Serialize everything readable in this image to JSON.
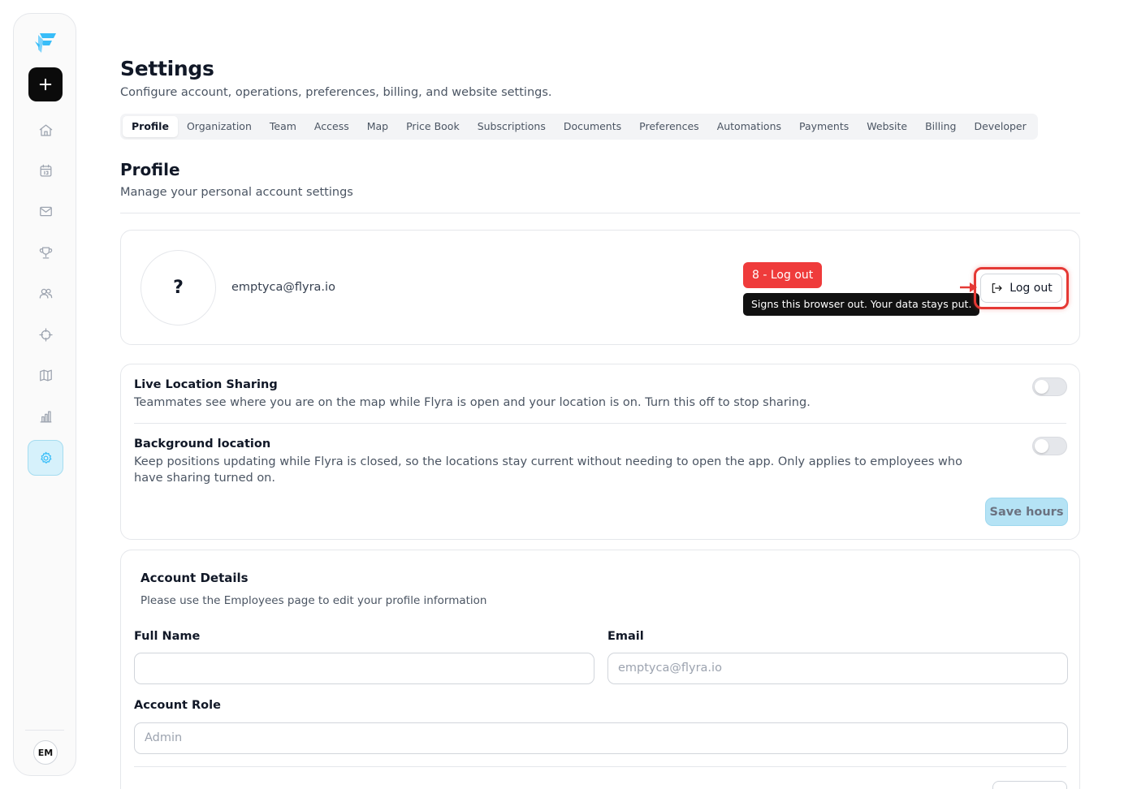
{
  "sidebar": {
    "logo": "flyra-logo-icon",
    "new_button_icon": "plus-icon",
    "items": [
      {
        "icon": "home-icon"
      },
      {
        "icon": "calendar-icon"
      },
      {
        "icon": "mail-icon"
      },
      {
        "icon": "trophy-icon"
      },
      {
        "icon": "users-icon"
      },
      {
        "icon": "crosshair-icon"
      },
      {
        "icon": "map-icon"
      },
      {
        "icon": "bar-chart-icon"
      },
      {
        "icon": "gear-icon",
        "active": true
      }
    ],
    "user_initials": "EM",
    "accent_color": "#38bdf8"
  },
  "header": {
    "title": "Settings",
    "subtitle": "Configure account, operations, preferences, billing, and website settings."
  },
  "tabs": [
    {
      "label": "Profile",
      "active": true
    },
    {
      "label": "Organization"
    },
    {
      "label": "Team"
    },
    {
      "label": "Access"
    },
    {
      "label": "Map"
    },
    {
      "label": "Price Book"
    },
    {
      "label": "Subscriptions"
    },
    {
      "label": "Documents"
    },
    {
      "label": "Preferences"
    },
    {
      "label": "Automations"
    },
    {
      "label": "Payments"
    },
    {
      "label": "Website"
    },
    {
      "label": "Billing"
    },
    {
      "label": "Developer"
    }
  ],
  "profile": {
    "title": "Profile",
    "subtitle": "Manage your personal account settings",
    "avatar_placeholder": "?",
    "email": "emptyca@flyra.io",
    "annotation_label": "8 - Log out",
    "tooltip": "Signs this browser out. Your data stays put.",
    "logout_label": "Log out",
    "annotation_color": "#e53935"
  },
  "location": {
    "live_title": "Live Location Sharing",
    "live_desc": "Teammates see where you are on the map while Flyra is open and your location is on. Turn this off to stop sharing.",
    "live_enabled": false,
    "bg_title": "Background location",
    "bg_desc": "Keep positions updating while Flyra is closed, so the locations stay current without needing to open the app. Only applies to employees who have sharing turned on.",
    "bg_enabled": false,
    "save_label": "Save hours"
  },
  "account": {
    "title": "Account Details",
    "subtitle": "Please use the Employees page to edit your profile information",
    "full_name_label": "Full Name",
    "full_name_value": "",
    "email_label": "Email",
    "email_value": "emptyca@flyra.io",
    "role_label": "Account Role",
    "role_value": "Admin"
  }
}
